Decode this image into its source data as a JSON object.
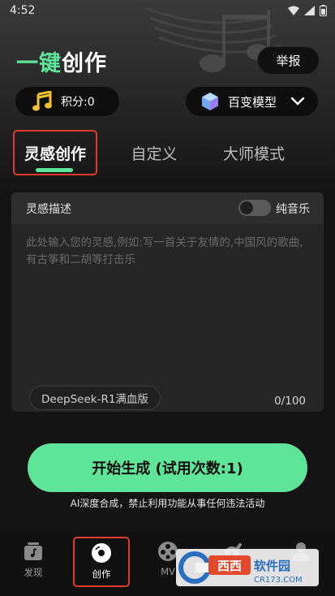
{
  "status_bar": {
    "time": "4:52"
  },
  "header": {
    "title_part1": "一键",
    "title_part2": "创作",
    "report_label": "举报"
  },
  "points": {
    "label": "积分:0",
    "icon": "music-note-icon"
  },
  "model": {
    "label": "百变模型",
    "icon": "cube-icon"
  },
  "tabs": [
    {
      "label": "灵感创作",
      "active": true
    },
    {
      "label": "自定义",
      "active": false
    },
    {
      "label": "大师模式",
      "active": false
    }
  ],
  "inspiration": {
    "title": "灵感描述",
    "toggle_label": "纯音乐",
    "toggle_on": false,
    "placeholder": "此处输入您的灵感,例如:写一首关于友情的,中国风的歌曲,有古筝和二胡等打击乐",
    "engine_chip": "DeepSeek-R1满血版",
    "char_count": "0/100"
  },
  "generate_button": "开始生成 (试用次数:1)",
  "disclaimer": "AI深度合成，禁止利用功能从事任何违法活动",
  "bottom_nav": [
    {
      "label": "发现",
      "icon": "discover-icon",
      "active": false
    },
    {
      "label": "创作",
      "icon": "disc-icon",
      "active": true
    },
    {
      "label": "MV",
      "icon": "film-reel-icon",
      "active": false
    },
    {
      "label": "",
      "icon": "guitar-icon",
      "active": false
    },
    {
      "label": "",
      "icon": "profile-icon",
      "active": false
    }
  ],
  "watermark": {
    "brand": "西西软件园",
    "url": "CR173.COM"
  },
  "colors": {
    "accent": "#5fe59a",
    "highlight": "#e03a2e",
    "background": "#141414"
  }
}
